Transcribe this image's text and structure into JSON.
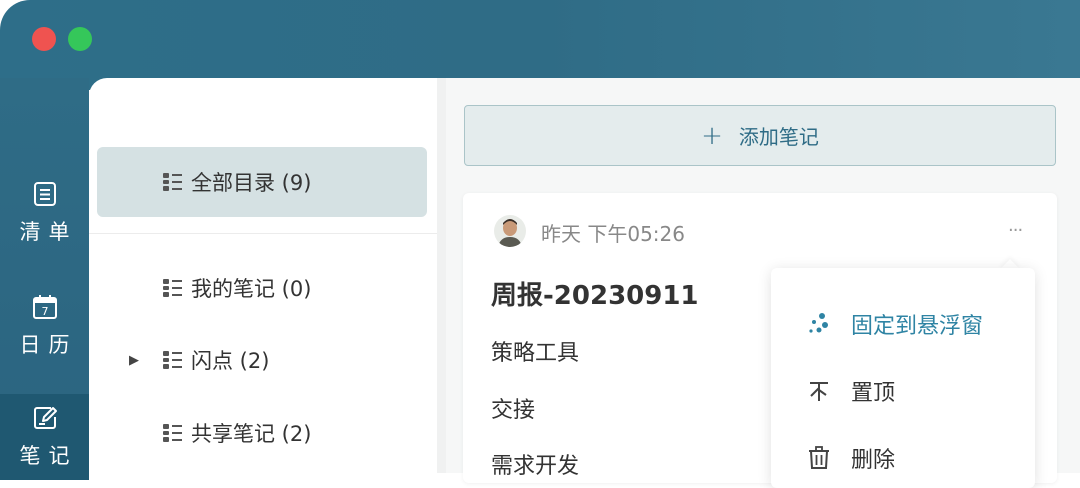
{
  "rail": {
    "items": [
      {
        "label": "清单",
        "icon": "list-icon"
      },
      {
        "label": "日历",
        "icon": "calendar-icon",
        "day": "7"
      },
      {
        "label": "笔记",
        "icon": "note-edit-icon"
      }
    ]
  },
  "catalog": {
    "items": [
      {
        "label": "全部目录 (9)"
      },
      {
        "label": "我的笔记 (0)"
      },
      {
        "label": "闪点 (2)"
      },
      {
        "label": "共享笔记 (2)"
      }
    ]
  },
  "notes": {
    "add_label": "添加笔记",
    "add_icon": "+",
    "card": {
      "time": "昨天 下午05:26",
      "more": "···",
      "title": "周报-20230911",
      "lines": [
        "策略工具",
        "交接",
        "需求开发"
      ]
    }
  },
  "menu": {
    "items": [
      {
        "label": "固定到悬浮窗"
      },
      {
        "label": "置顶"
      },
      {
        "label": "删除"
      }
    ]
  },
  "colors": {
    "brand": "#2f6c86",
    "accent": "#2f84a4",
    "rail_active": "#1f5871",
    "selected_bg": "#d5e1e3",
    "close": "#ef5350",
    "maximize": "#35c75a"
  }
}
